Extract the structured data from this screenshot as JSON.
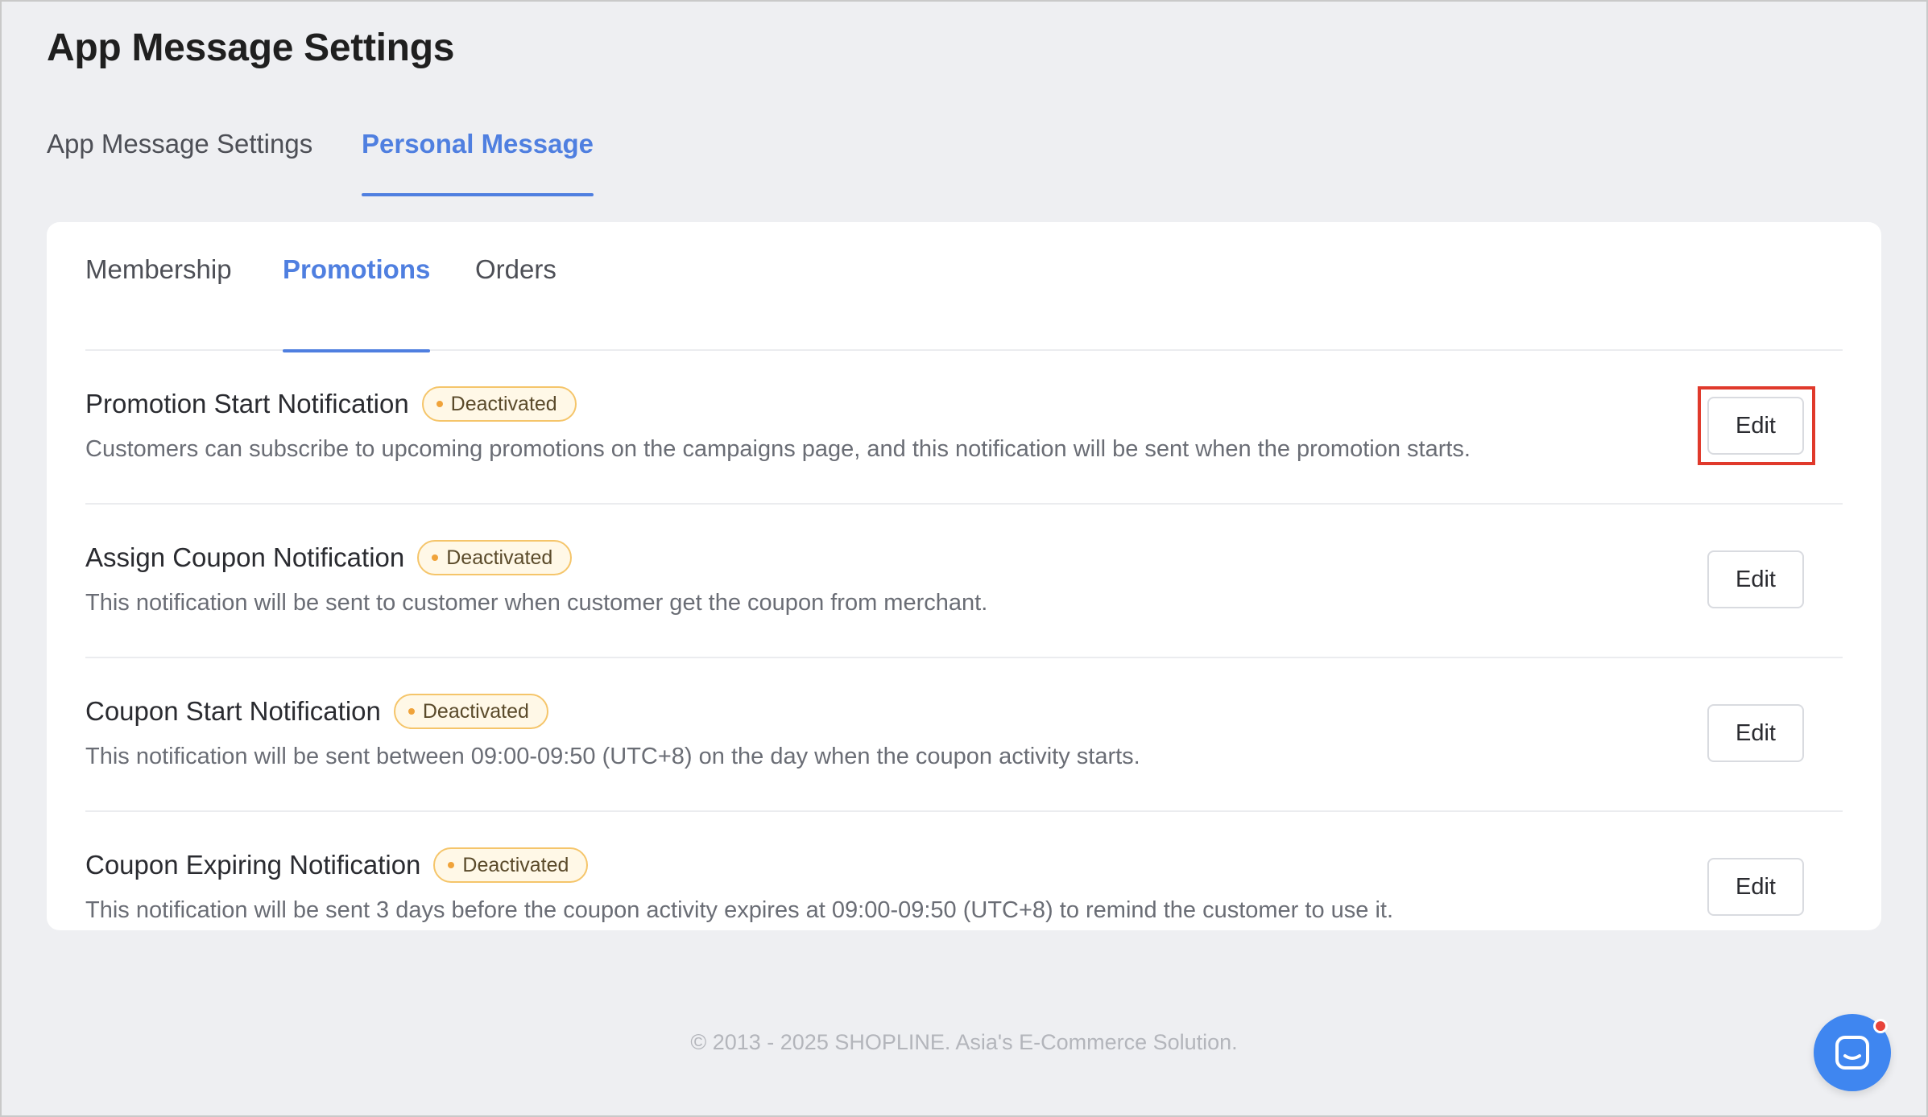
{
  "page": {
    "title": "App Message Settings"
  },
  "top_tabs": [
    {
      "label": "App Message Settings",
      "active": false
    },
    {
      "label": "Personal Message",
      "active": true
    }
  ],
  "sub_tabs": [
    {
      "label": "Membership",
      "active": false
    },
    {
      "label": "Promotions",
      "active": true
    },
    {
      "label": "Orders",
      "active": false
    }
  ],
  "notifications": [
    {
      "title": "Promotion Start Notification",
      "status": "Deactivated",
      "description": "Customers can subscribe to upcoming promotions on the campaigns page, and this notification will be sent when the promotion starts.",
      "edit_label": "Edit",
      "highlighted": true
    },
    {
      "title": "Assign Coupon Notification",
      "status": "Deactivated",
      "description": "This notification will be sent to customer when customer get the coupon from merchant.",
      "edit_label": "Edit",
      "highlighted": false
    },
    {
      "title": "Coupon Start Notification",
      "status": "Deactivated",
      "description": "This notification will be sent between 09:00-09:50 (UTC+8) on the day when the coupon activity starts.",
      "edit_label": "Edit",
      "highlighted": false
    },
    {
      "title": "Coupon Expiring Notification",
      "status": "Deactivated",
      "description": "This notification will be sent 3 days before the coupon activity expires at 09:00-09:50 (UTC+8) to remind the customer to use it.",
      "edit_label": "Edit",
      "highlighted": false
    }
  ],
  "footer": {
    "text": "© 2013 - 2025  SHOPLINE. Asia's E-Commerce Solution."
  },
  "colors": {
    "accent": "#4f7fe0",
    "badge_border": "#f5c56a",
    "badge_dot": "#f0a33a",
    "highlight": "#e0392b",
    "chat_button": "#3f86f0",
    "notification_dot": "#e8433a"
  },
  "icons": {
    "chat_button": "chat-icon",
    "badge": "status-dot-icon"
  }
}
